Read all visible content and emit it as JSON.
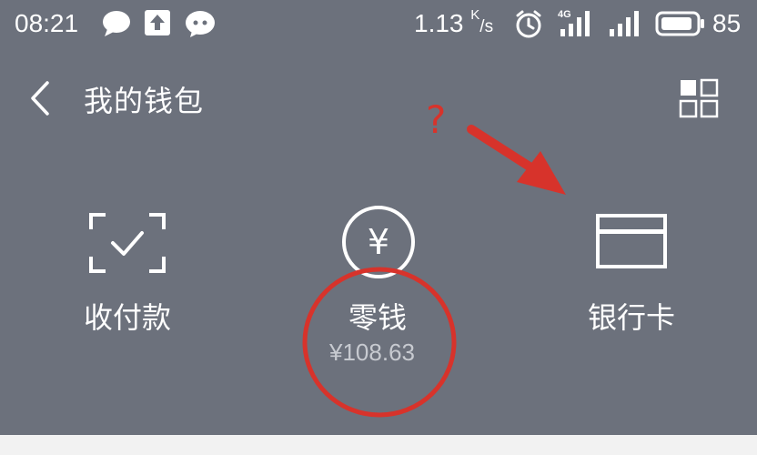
{
  "status_bar": {
    "time": "08:21",
    "network_speed": "1.13",
    "speed_unit_top": "K",
    "speed_unit_bottom": "/s",
    "signal_label": "4G",
    "battery_level": "85",
    "icons": [
      "chat-bubble-icon",
      "upload-icon",
      "wechat-icon",
      "alarm-icon",
      "signal-4g-icon",
      "signal-icon",
      "battery-icon"
    ]
  },
  "header": {
    "title": "我的钱包",
    "back_icon": "chevron-left-icon",
    "menu_icon": "grid-icon"
  },
  "features": [
    {
      "id": "pay-receive",
      "label": "收付款",
      "icon": "scan-check-icon"
    },
    {
      "id": "change",
      "label": "零钱",
      "amount": "¥108.63",
      "icon": "yen-circle-icon",
      "icon_glyph": "¥"
    },
    {
      "id": "bank-card",
      "label": "银行卡",
      "icon": "card-icon"
    }
  ],
  "annotations": {
    "question_mark": "?",
    "color": "#d7332b"
  },
  "colors": {
    "background": "#6c717c",
    "text": "#ffffff",
    "muted_text": "#c7cad0"
  }
}
